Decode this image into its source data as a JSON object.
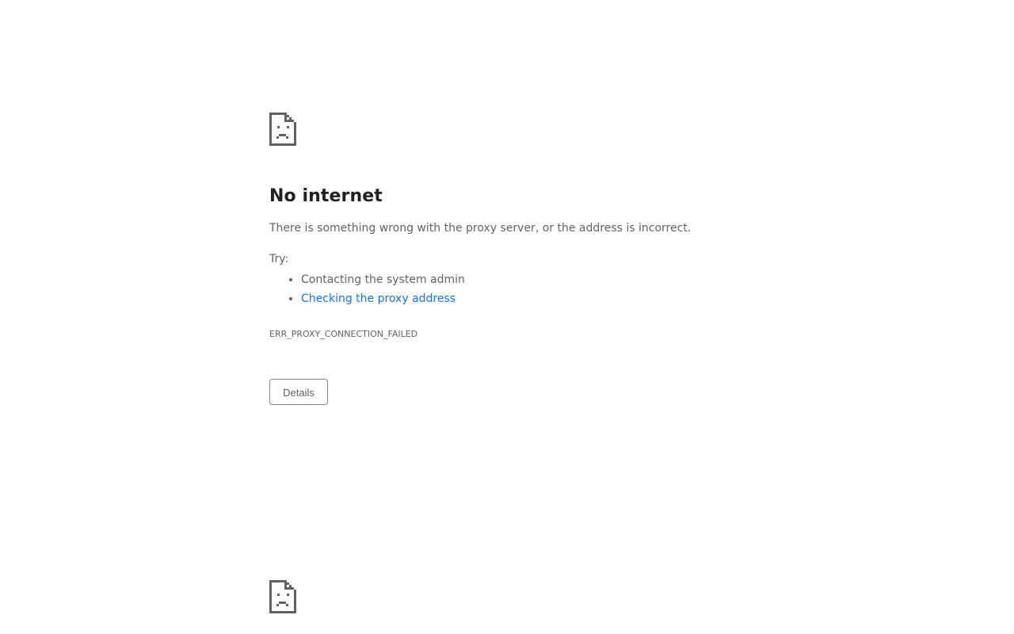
{
  "error_page": {
    "icon": "sad-page-icon",
    "title": "No internet",
    "description": "There is something wrong with the proxy server, or the address is incorrect.",
    "try_label": "Try:",
    "suggestions": [
      "Contacting the system admin",
      "Checking the proxy address"
    ],
    "error_code": "ERR_PROXY_CONNECTION_FAILED",
    "details_button": "Details"
  },
  "colors": {
    "title": "#202124",
    "text": "#5f6368",
    "link": "#1a73e8",
    "icon": "#5f6368"
  }
}
